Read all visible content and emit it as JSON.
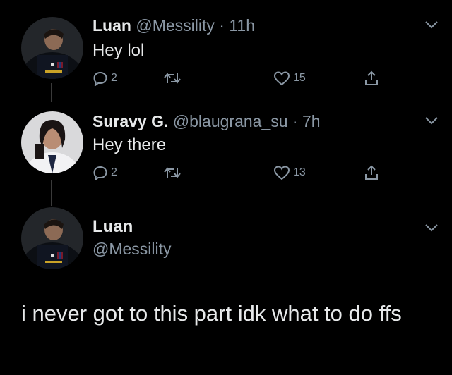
{
  "colors": {
    "background": "#000000",
    "text": "#e7e9ea",
    "secondary": "#8b98a5",
    "thread_line": "#3a3a3a"
  },
  "tweets": [
    {
      "name": "Luan",
      "handle": "@Messility",
      "dot": "·",
      "time": "11h",
      "text": "Hey lol",
      "replies": "2",
      "likes": "15",
      "avatar_icon": "player-avatar"
    },
    {
      "name": "Suravy G.",
      "handle": "@blaugrana_su",
      "dot": "·",
      "time": "7h",
      "text": "Hey there",
      "replies": "2",
      "likes": "13",
      "avatar_icon": "user-avatar"
    }
  ],
  "main_tweet": {
    "name": "Luan",
    "handle": "@Messility",
    "text": "i never got to this part idk what to do ffs",
    "avatar_icon": "player-avatar"
  },
  "icons": {
    "reply": "reply-icon",
    "retweet": "retweet-icon",
    "like": "heart-icon",
    "share": "share-icon",
    "menu": "chevron-down-icon"
  }
}
